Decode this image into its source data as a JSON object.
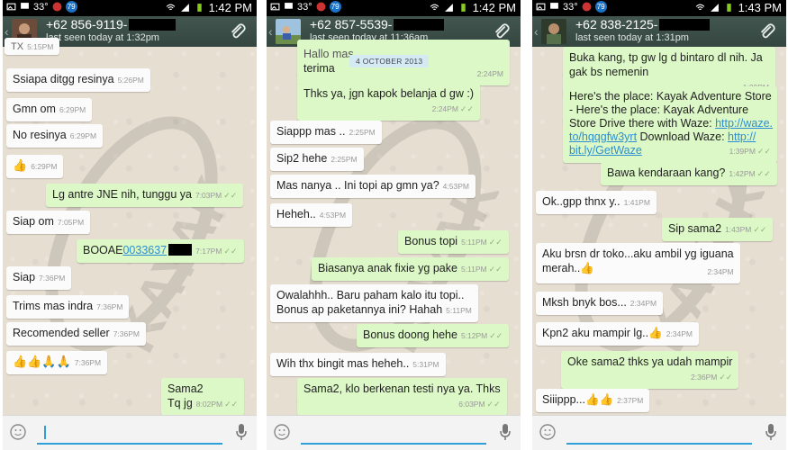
{
  "screens": [
    {
      "status": {
        "temp": "33°",
        "badge": "79",
        "time": "1:42 PM"
      },
      "contact": {
        "number": "+62 856-9119-",
        "seen": "last seen today at 1:32pm"
      },
      "messages": [
        {
          "text": "Ssiapa ditgg resinya",
          "time": "5:26PM"
        },
        {
          "text": "Gmn om",
          "time": "6:29PM"
        },
        {
          "text": "No resinya",
          "time": "6:29PM"
        },
        {
          "text": "👍",
          "time": "6:29PM"
        },
        {
          "text": "Lg antre JNE nih, tunggu ya",
          "time": "7:03PM"
        },
        {
          "text": "Siap om",
          "time": "7:05PM"
        },
        {
          "text_prefix": "BOOAE",
          "link": "0033637",
          "time": "7:17PM"
        },
        {
          "text": "Siap",
          "time": "7:36PM"
        },
        {
          "text": "Trims mas indra",
          "time": "7:36PM"
        },
        {
          "text": "Recomended seller",
          "time": "7:36PM"
        },
        {
          "text": "👍👍🙏🙏",
          "time": "7:36PM"
        },
        {
          "line1": "Sama2",
          "line2": "Tq jg",
          "time": "8:02PM"
        }
      ],
      "top_partial_time": "5:15PM"
    },
    {
      "status": {
        "temp": "33°",
        "badge": "79",
        "time": "1:42 PM"
      },
      "contact": {
        "number": "+62 857-5539-",
        "seen": "last seen today at 11:36am"
      },
      "date_pill": "4 OCTOBER 2013",
      "messages": [
        {
          "line1": "Hallo mas",
          "line2": "terima",
          "time": "2:24PM"
        },
        {
          "text": "Thks ya, jgn kapok belanja d gw :)",
          "time": "2:24PM"
        },
        {
          "text": "Siappp mas ..",
          "time": "2:25PM"
        },
        {
          "text": "Sip2 hehe",
          "time": "2:25PM"
        },
        {
          "text": "Mas nanya .. Ini topi ap gmn ya?",
          "time": "4:53PM"
        },
        {
          "text": "Heheh..",
          "time": "4:53PM"
        },
        {
          "text": "Bonus topi",
          "time": "5:11PM"
        },
        {
          "text": "Biasanya anak fixie yg pake",
          "time": "5:11PM"
        },
        {
          "line1": "Owalahhh.. Baru paham kalo itu topi..",
          "line2": "Bonus ap paketannya ini? Hahah",
          "time": "5:11PM"
        },
        {
          "text": "Bonus doong hehe",
          "time": "5:12PM"
        },
        {
          "text": "Wih thx bingit mas heheh..",
          "time": "5:31PM"
        },
        {
          "text": "Sama2, klo berkenan testi nya ya. Thks",
          "time": "6:03PM"
        }
      ]
    },
    {
      "status": {
        "temp": "33°",
        "badge": "79",
        "time": "1:43 PM"
      },
      "contact": {
        "number": "+62 838-2125-",
        "seen": "last seen today at 1:31pm"
      },
      "messages": [
        {
          "line1": "Buka kang, tp gw lg d bintaro dl nih. Ja",
          "line2": "gak bs nemenin",
          "time": "1:29PM"
        },
        {
          "l1": "Here's the place: Kayak Adventure Store",
          "l2": "- Here's the place: Kayak Adventure",
          "l3a": "Store Drive there with Waze: ",
          "l3b": "http://waze.",
          "l4a": "to/hqqgfw3yrt",
          "l4b": " Download Waze: ",
          "l4c": "http://",
          "l5": "bit.ly/GetWaze",
          "time": "1:39PM"
        },
        {
          "text": "Bawa kendaraan kang?",
          "time": "1:42PM"
        },
        {
          "text": "Ok..gpp thnx y..",
          "time": "1:41PM"
        },
        {
          "text": "Sip sama2",
          "time": "1:43PM"
        },
        {
          "line1": "Aku brsn dr toko...aku ambil yg iguana",
          "line2": "merah..👍",
          "time": "2:34PM"
        },
        {
          "text": "Mksh bnyk bos...",
          "time": "2:34PM"
        },
        {
          "text": "Kpn2 aku mampir lg..👍",
          "time": "2:34PM"
        },
        {
          "text": "Oke sama2 thks ya udah mampir",
          "time": "2:36PM"
        },
        {
          "text": "Siiippp...👍👍",
          "time": "2:37PM"
        }
      ]
    }
  ],
  "colors": {
    "header": "#3a4d46",
    "incoming": "#fbfbfb",
    "outgoing": "#dcf8c6",
    "link": "#2e8fd0",
    "input_accent": "#2f9fd8"
  },
  "icons": [
    "back-chevron-icon",
    "attach-paperclip-icon",
    "smiley-icon",
    "microphone-icon",
    "wifi-icon",
    "signal-icon",
    "battery-icon"
  ]
}
